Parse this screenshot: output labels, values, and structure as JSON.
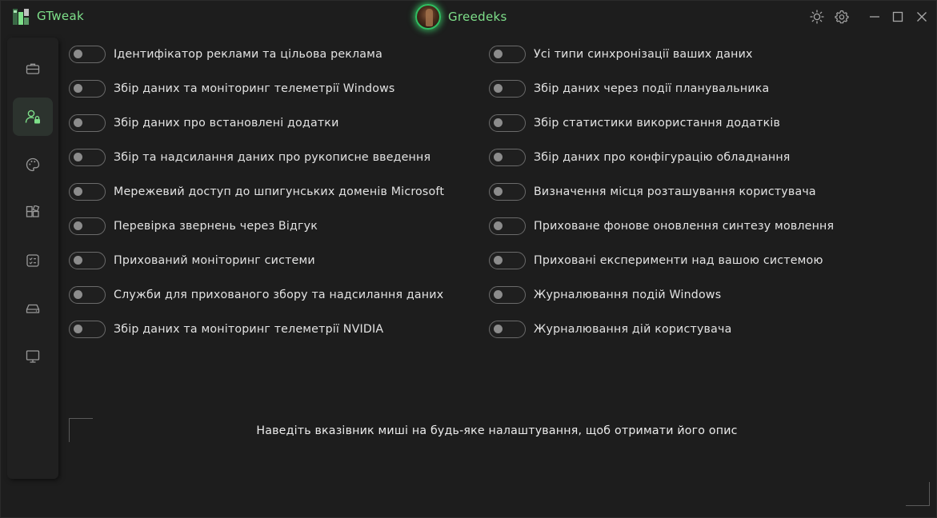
{
  "app": {
    "title": "GTweak",
    "accent": "#7ee08a"
  },
  "profile": {
    "name": "Greedeks"
  },
  "titlebar": {
    "theme_icon": "sun-icon",
    "settings_icon": "gear-icon",
    "minimize_icon": "minimize-icon",
    "maximize_icon": "maximize-icon",
    "close_icon": "close-icon"
  },
  "sidebar": {
    "items": [
      {
        "icon": "briefcase-icon",
        "active": false
      },
      {
        "icon": "user-lock-icon",
        "active": true
      },
      {
        "icon": "palette-icon",
        "active": false
      },
      {
        "icon": "apps-grid-icon",
        "active": false
      },
      {
        "icon": "checklist-icon",
        "active": false
      },
      {
        "icon": "drive-icon",
        "active": false
      },
      {
        "icon": "monitor-icon",
        "active": false
      }
    ]
  },
  "toggles": {
    "left": [
      {
        "label": "Ідентифікатор реклами та цільова реклама",
        "on": false
      },
      {
        "label": "Збір даних та моніторинг телеметрії Windows",
        "on": false
      },
      {
        "label": "Збір даних про встановлені додатки",
        "on": false
      },
      {
        "label": "Збір та надсилання даних про рукописне введення",
        "on": false
      },
      {
        "label": "Мережевий доступ до шпигунських доменів Microsoft",
        "on": false
      },
      {
        "label": "Перевірка звернень через Відгук",
        "on": false
      },
      {
        "label": "Прихований моніторинг системи",
        "on": false
      },
      {
        "label": "Служби для прихованого збору та надсилання даних",
        "on": false
      },
      {
        "label": "Збір даних та моніторинг телеметрії NVIDIA",
        "on": false
      }
    ],
    "right": [
      {
        "label": "Усі типи синхронізації ваших даних",
        "on": false
      },
      {
        "label": "Збір даних через події планувальника",
        "on": false
      },
      {
        "label": "Збір статистики використання додатків",
        "on": false
      },
      {
        "label": "Збір даних про конфігурацію обладнання",
        "on": false
      },
      {
        "label": "Визначення місця розташування користувача",
        "on": false
      },
      {
        "label": "Приховане фонове оновлення синтезу мовлення",
        "on": false
      },
      {
        "label": "Приховані експерименти над вашою системою",
        "on": false
      },
      {
        "label": "Журналювання подій Windows",
        "on": false
      },
      {
        "label": "Журналювання дій користувача",
        "on": false
      }
    ]
  },
  "description": {
    "text": "Наведіть вказівник миші на будь-яке налаштування, щоб отримати його опис"
  }
}
